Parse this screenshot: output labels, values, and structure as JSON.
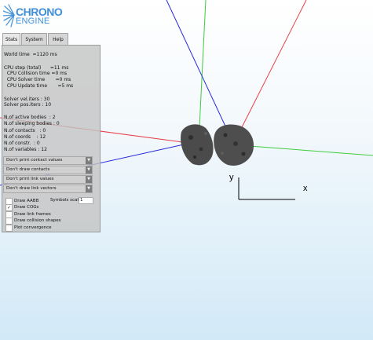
{
  "logo": {
    "line1": "CHRONO",
    "line2": "ENGINE"
  },
  "tabs": [
    {
      "label": "Stats",
      "active": true
    },
    {
      "label": "System",
      "active": false
    },
    {
      "label": "Help",
      "active": false
    }
  ],
  "stats": {
    "world_time": "World time  =1120 ms",
    "cpu_step": "CPU step (total)      =11 ms",
    "cpu_collision": "  CPU Collision time =0 ms",
    "cpu_solver": "  CPU Solver time       =0 ms",
    "cpu_update": "  CPU Update time       =5 ms",
    "solver_vel": "Solver vel.iters : 30",
    "solver_pos": "Solver pos.iters : 10",
    "n_active": "N.of active bodies  : 2",
    "n_sleeping": "N.of sleeping bodies : 0",
    "n_contacts": "N.of contacts   : 0",
    "n_coords": "N.of coords    : 12",
    "n_constr": "N.of constr.  : 0",
    "n_variables": "N.of variables : 12"
  },
  "dropdowns": [
    {
      "label": "Don't print contact values"
    },
    {
      "label": "Don't draw contacts"
    },
    {
      "label": "Don't print link values"
    },
    {
      "label": "Don't draw link vectors"
    }
  ],
  "checkboxes": [
    {
      "label": "Draw AABB",
      "checked": false
    },
    {
      "label": "Draw COGs",
      "checked": true
    },
    {
      "label": "Draw link frames",
      "checked": false
    },
    {
      "label": "Draw collision shapes",
      "checked": false
    },
    {
      "label": "Plot convergence",
      "checked": false
    }
  ],
  "symbols": {
    "label": "Symbols scale",
    "value": "1"
  },
  "axes": {
    "x_label": "x",
    "y_label": "y"
  },
  "colors": {
    "x_axis": "#e8404a",
    "y_axis": "#3fcc3f",
    "z_axis": "#2a2adc",
    "rock": "#4a4a4a"
  },
  "icons": {
    "dropdown_arrow": "chevron-down-icon",
    "check": "checkmark-icon"
  }
}
